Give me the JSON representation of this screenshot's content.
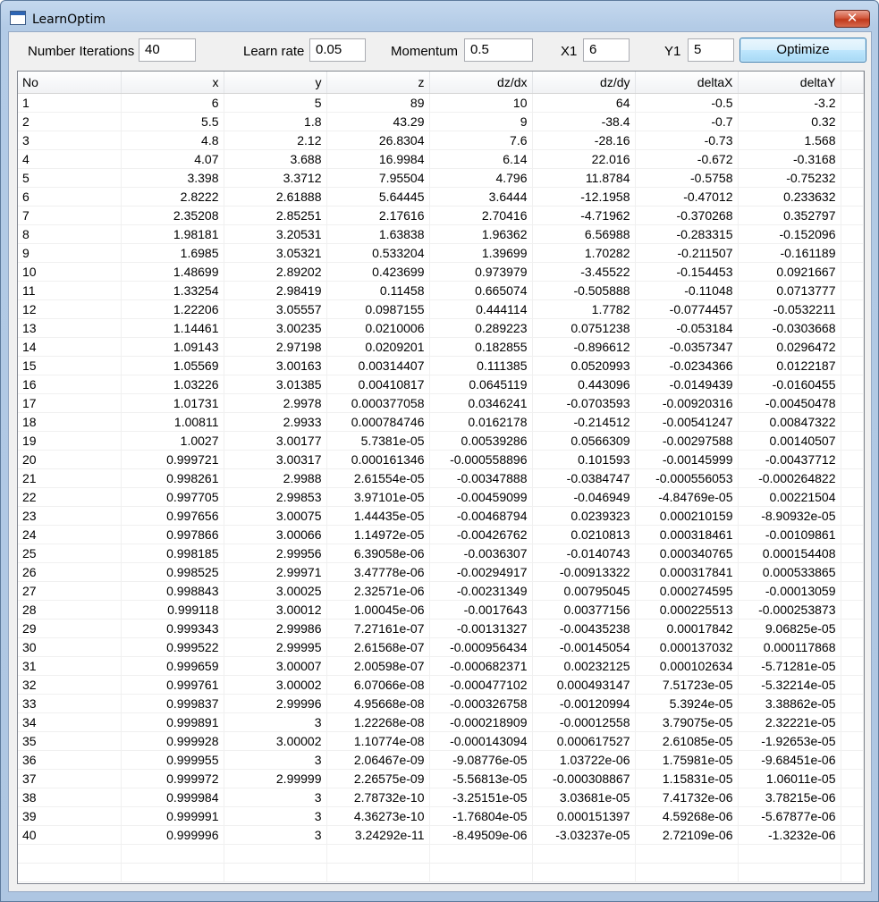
{
  "window": {
    "title": "LearnOptim",
    "close_glyph": "✕"
  },
  "controls": {
    "iterations_label": "Number Iterations",
    "iterations_value": "40",
    "learn_rate_label": "Learn rate",
    "learn_rate_value": "0.05",
    "momentum_label": "Momentum",
    "momentum_value": "0.5",
    "x1_label": "X1",
    "x1_value": "6",
    "y1_label": "Y1",
    "y1_value": "5",
    "optimize_label": "Optimize"
  },
  "table": {
    "columns": [
      "No",
      "x",
      "y",
      "z",
      "dz/dx",
      "dz/dy",
      "deltaX",
      "deltaY"
    ],
    "rows": [
      [
        "1",
        "6",
        "5",
        "89",
        "10",
        "64",
        "-0.5",
        "-3.2"
      ],
      [
        "2",
        "5.5",
        "1.8",
        "43.29",
        "9",
        "-38.4",
        "-0.7",
        "0.32"
      ],
      [
        "3",
        "4.8",
        "2.12",
        "26.8304",
        "7.6",
        "-28.16",
        "-0.73",
        "1.568"
      ],
      [
        "4",
        "4.07",
        "3.688",
        "16.9984",
        "6.14",
        "22.016",
        "-0.672",
        "-0.3168"
      ],
      [
        "5",
        "3.398",
        "3.3712",
        "7.95504",
        "4.796",
        "11.8784",
        "-0.5758",
        "-0.75232"
      ],
      [
        "6",
        "2.8222",
        "2.61888",
        "5.64445",
        "3.6444",
        "-12.1958",
        "-0.47012",
        "0.233632"
      ],
      [
        "7",
        "2.35208",
        "2.85251",
        "2.17616",
        "2.70416",
        "-4.71962",
        "-0.370268",
        "0.352797"
      ],
      [
        "8",
        "1.98181",
        "3.20531",
        "1.63838",
        "1.96362",
        "6.56988",
        "-0.283315",
        "-0.152096"
      ],
      [
        "9",
        "1.6985",
        "3.05321",
        "0.533204",
        "1.39699",
        "1.70282",
        "-0.211507",
        "-0.161189"
      ],
      [
        "10",
        "1.48699",
        "2.89202",
        "0.423699",
        "0.973979",
        "-3.45522",
        "-0.154453",
        "0.0921667"
      ],
      [
        "11",
        "1.33254",
        "2.98419",
        "0.11458",
        "0.665074",
        "-0.505888",
        "-0.11048",
        "0.0713777"
      ],
      [
        "12",
        "1.22206",
        "3.05557",
        "0.0987155",
        "0.444114",
        "1.7782",
        "-0.0774457",
        "-0.0532211"
      ],
      [
        "13",
        "1.14461",
        "3.00235",
        "0.0210006",
        "0.289223",
        "0.0751238",
        "-0.053184",
        "-0.0303668"
      ],
      [
        "14",
        "1.09143",
        "2.97198",
        "0.0209201",
        "0.182855",
        "-0.896612",
        "-0.0357347",
        "0.0296472"
      ],
      [
        "15",
        "1.05569",
        "3.00163",
        "0.00314407",
        "0.111385",
        "0.0520993",
        "-0.0234366",
        "0.0122187"
      ],
      [
        "16",
        "1.03226",
        "3.01385",
        "0.00410817",
        "0.0645119",
        "0.443096",
        "-0.0149439",
        "-0.0160455"
      ],
      [
        "17",
        "1.01731",
        "2.9978",
        "0.000377058",
        "0.0346241",
        "-0.0703593",
        "-0.00920316",
        "-0.00450478"
      ],
      [
        "18",
        "1.00811",
        "2.9933",
        "0.000784746",
        "0.0162178",
        "-0.214512",
        "-0.00541247",
        "0.00847322"
      ],
      [
        "19",
        "1.0027",
        "3.00177",
        "5.7381e-05",
        "0.00539286",
        "0.0566309",
        "-0.00297588",
        "0.00140507"
      ],
      [
        "20",
        "0.999721",
        "3.00317",
        "0.000161346",
        "-0.000558896",
        "0.101593",
        "-0.00145999",
        "-0.00437712"
      ],
      [
        "21",
        "0.998261",
        "2.9988",
        "2.61554e-05",
        "-0.00347888",
        "-0.0384747",
        "-0.000556053",
        "-0.000264822"
      ],
      [
        "22",
        "0.997705",
        "2.99853",
        "3.97101e-05",
        "-0.00459099",
        "-0.046949",
        "-4.84769e-05",
        "0.00221504"
      ],
      [
        "23",
        "0.997656",
        "3.00075",
        "1.44435e-05",
        "-0.00468794",
        "0.0239323",
        "0.000210159",
        "-8.90932e-05"
      ],
      [
        "24",
        "0.997866",
        "3.00066",
        "1.14972e-05",
        "-0.00426762",
        "0.0210813",
        "0.000318461",
        "-0.00109861"
      ],
      [
        "25",
        "0.998185",
        "2.99956",
        "6.39058e-06",
        "-0.0036307",
        "-0.0140743",
        "0.000340765",
        "0.000154408"
      ],
      [
        "26",
        "0.998525",
        "2.99971",
        "3.47778e-06",
        "-0.00294917",
        "-0.00913322",
        "0.000317841",
        "0.000533865"
      ],
      [
        "27",
        "0.998843",
        "3.00025",
        "2.32571e-06",
        "-0.00231349",
        "0.00795045",
        "0.000274595",
        "-0.00013059"
      ],
      [
        "28",
        "0.999118",
        "3.00012",
        "1.00045e-06",
        "-0.0017643",
        "0.00377156",
        "0.000225513",
        "-0.000253873"
      ],
      [
        "29",
        "0.999343",
        "2.99986",
        "7.27161e-07",
        "-0.00131327",
        "-0.00435238",
        "0.00017842",
        "9.06825e-05"
      ],
      [
        "30",
        "0.999522",
        "2.99995",
        "2.61568e-07",
        "-0.000956434",
        "-0.00145054",
        "0.000137032",
        "0.000117868"
      ],
      [
        "31",
        "0.999659",
        "3.00007",
        "2.00598e-07",
        "-0.000682371",
        "0.00232125",
        "0.000102634",
        "-5.71281e-05"
      ],
      [
        "32",
        "0.999761",
        "3.00002",
        "6.07066e-08",
        "-0.000477102",
        "0.000493147",
        "7.51723e-05",
        "-5.32214e-05"
      ],
      [
        "33",
        "0.999837",
        "2.99996",
        "4.95668e-08",
        "-0.000326758",
        "-0.00120994",
        "5.3924e-05",
        "3.38862e-05"
      ],
      [
        "34",
        "0.999891",
        "3",
        "1.22268e-08",
        "-0.000218909",
        "-0.00012558",
        "3.79075e-05",
        "2.32221e-05"
      ],
      [
        "35",
        "0.999928",
        "3.00002",
        "1.10774e-08",
        "-0.000143094",
        "0.000617527",
        "2.61085e-05",
        "-1.92653e-05"
      ],
      [
        "36",
        "0.999955",
        "3",
        "2.06467e-09",
        "-9.08776e-05",
        "1.03722e-06",
        "1.75981e-05",
        "-9.68451e-06"
      ],
      [
        "37",
        "0.999972",
        "2.99999",
        "2.26575e-09",
        "-5.56813e-05",
        "-0.000308867",
        "1.15831e-05",
        "1.06011e-05"
      ],
      [
        "38",
        "0.999984",
        "3",
        "2.78732e-10",
        "-3.25151e-05",
        "3.03681e-05",
        "7.41732e-06",
        "3.78215e-06"
      ],
      [
        "39",
        "0.999991",
        "3",
        "4.36273e-10",
        "-1.76804e-05",
        "0.000151397",
        "4.59268e-06",
        "-5.67877e-06"
      ],
      [
        "40",
        "0.999996",
        "3",
        "3.24292e-11",
        "-8.49509e-06",
        "-3.03237e-05",
        "2.72109e-06",
        "-1.3232e-06"
      ]
    ]
  }
}
